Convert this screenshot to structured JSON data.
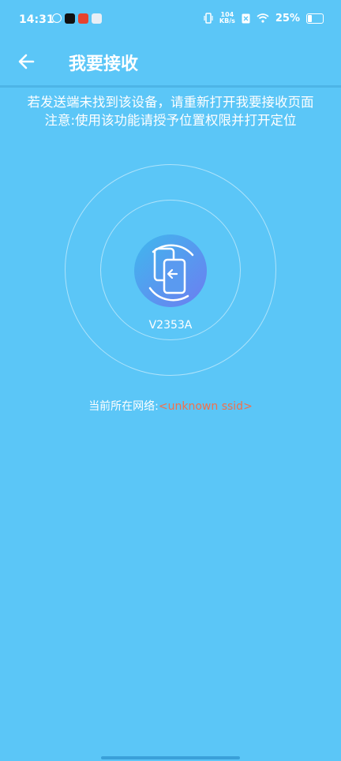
{
  "status_bar": {
    "time": "14:31",
    "net_speed_value": "104",
    "net_speed_unit": "KB/s",
    "battery_percent": "25%",
    "battery_level": 0.25
  },
  "app_bar": {
    "title": "我要接收",
    "back_icon": "arrow-left-icon"
  },
  "notice": {
    "line1": "若发送端未找到该设备，请重新打开我要接收页面",
    "line2": "注意:使用该功能请授予位置权限并打开定位"
  },
  "device": {
    "name": "V2353A",
    "icon": "phone-transfer-icon"
  },
  "network": {
    "label": "当前所在网络:",
    "value": "<unknown ssid>"
  },
  "colors": {
    "background": "#5bc6f7",
    "network_value": "#f36f4a"
  }
}
